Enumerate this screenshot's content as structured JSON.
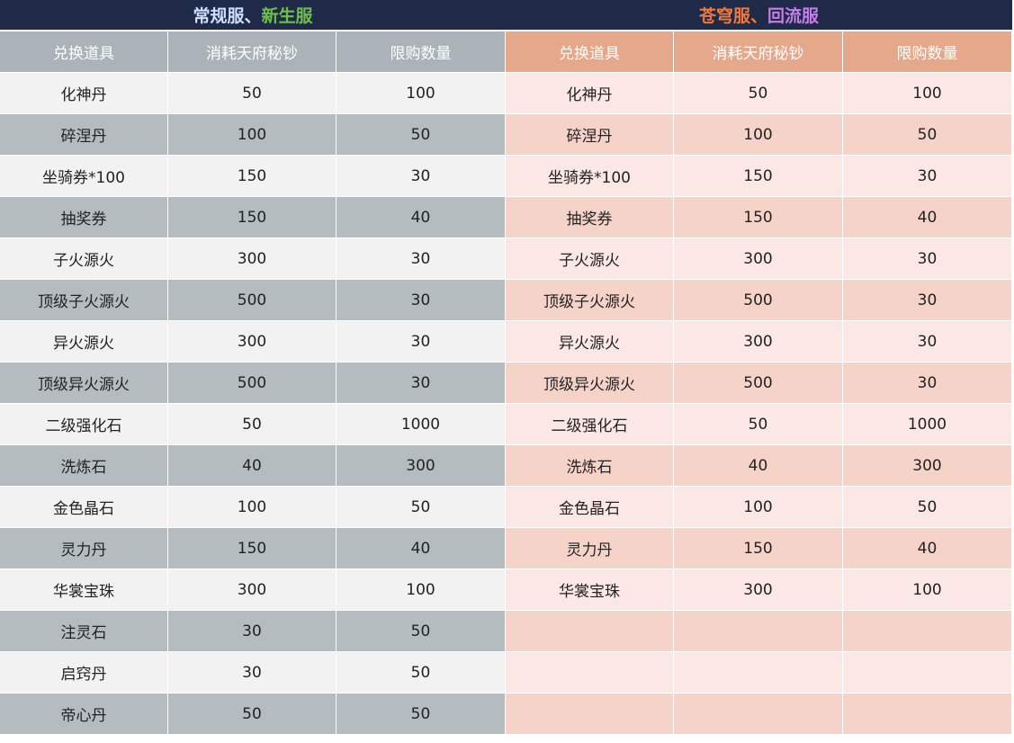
{
  "left": {
    "title_parts": [
      {
        "text": "常规服",
        "color": "#cfe0ff"
      },
      {
        "text": "、",
        "color": "#cfe0ff"
      },
      {
        "text": "新生服",
        "color": "#6fc04a"
      }
    ],
    "headers": [
      "兑换道具",
      "消耗天府秘钞",
      "限购数量"
    ],
    "rows": [
      [
        "化神丹",
        "50",
        "100"
      ],
      [
        "碎涅丹",
        "100",
        "50"
      ],
      [
        "坐骑券*100",
        "150",
        "30"
      ],
      [
        "抽奖券",
        "150",
        "40"
      ],
      [
        "子火源火",
        "300",
        "30"
      ],
      [
        "顶级子火源火",
        "500",
        "30"
      ],
      [
        "异火源火",
        "300",
        "30"
      ],
      [
        "顶级异火源火",
        "500",
        "30"
      ],
      [
        "二级强化石",
        "50",
        "1000"
      ],
      [
        "洗炼石",
        "40",
        "300"
      ],
      [
        "金色晶石",
        "100",
        "50"
      ],
      [
        "灵力丹",
        "150",
        "40"
      ],
      [
        "华裳宝珠",
        "300",
        "100"
      ],
      [
        "注灵石",
        "30",
        "50"
      ],
      [
        "启窍丹",
        "30",
        "50"
      ],
      [
        "帝心丹",
        "50",
        "50"
      ]
    ]
  },
  "right": {
    "title_parts": [
      {
        "text": "苍穹服",
        "color": "#f07a3a"
      },
      {
        "text": "、",
        "color": "#f07a3a"
      },
      {
        "text": "回流服",
        "color": "#c77ee8"
      }
    ],
    "headers": [
      "兑换道具",
      "消耗天府秘钞",
      "限购数量"
    ],
    "rows": [
      [
        "化神丹",
        "50",
        "100"
      ],
      [
        "碎涅丹",
        "100",
        "50"
      ],
      [
        "坐骑券*100",
        "150",
        "30"
      ],
      [
        "抽奖券",
        "150",
        "40"
      ],
      [
        "子火源火",
        "300",
        "30"
      ],
      [
        "顶级子火源火",
        "500",
        "30"
      ],
      [
        "异火源火",
        "300",
        "30"
      ],
      [
        "顶级异火源火",
        "500",
        "30"
      ],
      [
        "二级强化石",
        "50",
        "1000"
      ],
      [
        "洗炼石",
        "40",
        "300"
      ],
      [
        "金色晶石",
        "100",
        "50"
      ],
      [
        "灵力丹",
        "150",
        "40"
      ],
      [
        "华裳宝珠",
        "300",
        "100"
      ],
      [
        "",
        "",
        ""
      ],
      [
        "",
        "",
        ""
      ],
      [
        "",
        "",
        ""
      ]
    ]
  }
}
